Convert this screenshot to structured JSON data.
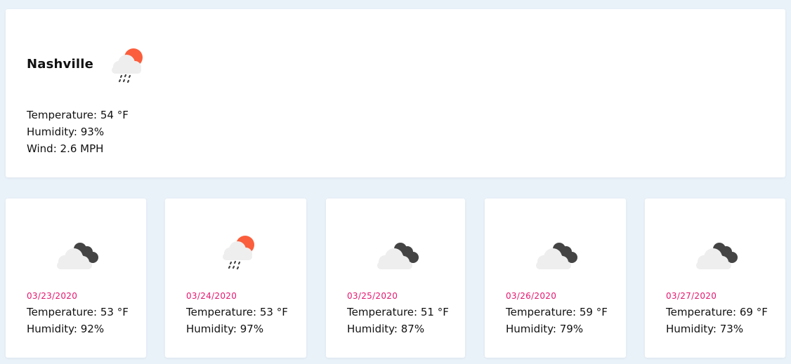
{
  "current": {
    "city": "Nashville",
    "icon": "rain-sun-cloud-icon",
    "temperature": "Temperature: 54 °F",
    "humidity": "Humidity: 93%",
    "wind": "Wind: 2.6 MPH"
  },
  "forecast": [
    {
      "date": "03/23/2020",
      "icon": "dark-clouds-icon",
      "temperature": "Temperature: 53 °F",
      "humidity": "Humidity: 92%"
    },
    {
      "date": "03/24/2020",
      "icon": "rain-sun-cloud-icon",
      "temperature": "Temperature: 53 °F",
      "humidity": "Humidity: 97%"
    },
    {
      "date": "03/25/2020",
      "icon": "dark-clouds-icon",
      "temperature": "Temperature: 51 °F",
      "humidity": "Humidity: 87%"
    },
    {
      "date": "03/26/2020",
      "icon": "dark-clouds-icon",
      "temperature": "Temperature: 59 °F",
      "humidity": "Humidity: 79%"
    },
    {
      "date": "03/27/2020",
      "icon": "dark-clouds-icon",
      "temperature": "Temperature: 69 °F",
      "humidity": "Humidity: 73%"
    }
  ],
  "colors": {
    "background": "#e9f1f9",
    "date_accent": "#e5176f",
    "sun": "#fb5e3c",
    "cloud_light": "#eeeeee",
    "cloud_dark": "#444444"
  }
}
